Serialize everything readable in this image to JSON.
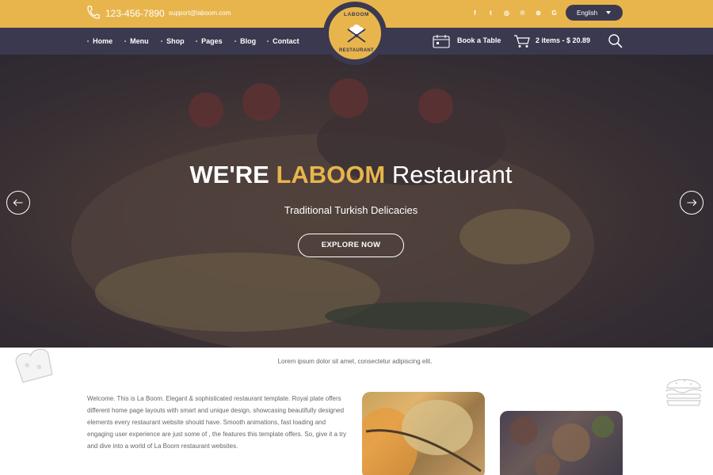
{
  "topbar": {
    "phone": "123-456-7890",
    "email": "support@laboom.com",
    "socials": [
      {
        "icon": "facebook-icon",
        "glyph": "f"
      },
      {
        "icon": "twitter-icon",
        "glyph": "t"
      },
      {
        "icon": "instagram-icon",
        "glyph": "◎"
      },
      {
        "icon": "pinterest-icon",
        "glyph": "℗"
      },
      {
        "icon": "tripadvisor-icon",
        "glyph": "⊚"
      },
      {
        "icon": "google-icon",
        "glyph": "G"
      }
    ],
    "language": "English"
  },
  "logo": {
    "top_text": "LABOOM",
    "bottom_text": "RESTAURANT"
  },
  "nav": {
    "items": [
      "Home",
      "Menu",
      "Shop",
      "Pages",
      "Blog",
      "Contact"
    ],
    "book_label": "Book a Table",
    "cart_label": "2 items - $ 20.89"
  },
  "hero": {
    "title_part1": "WE'RE ",
    "title_accent": "LABOOM",
    "title_part2": " Restaurant",
    "subtitle": "Traditional Turkish Delicacies",
    "button": "EXPLORE NOW"
  },
  "content": {
    "tagline": "Lorem ipsum dolor sit amet, consectetur adipiscing elit.",
    "about": "Welcome. This is La Boom. Elegant & sophisticated restaurant template. Royal plate offers different home page layouts with smart and unique design, showcasing beautifully designed elements every restaurant website should have. Smooth animations, fast loading and engaging user experience are just some of , the features this template offers. So, give it a try and dive into a world of La Boom restaurant websites."
  },
  "colors": {
    "accent": "#e8b54d",
    "dark": "#3a3950"
  }
}
